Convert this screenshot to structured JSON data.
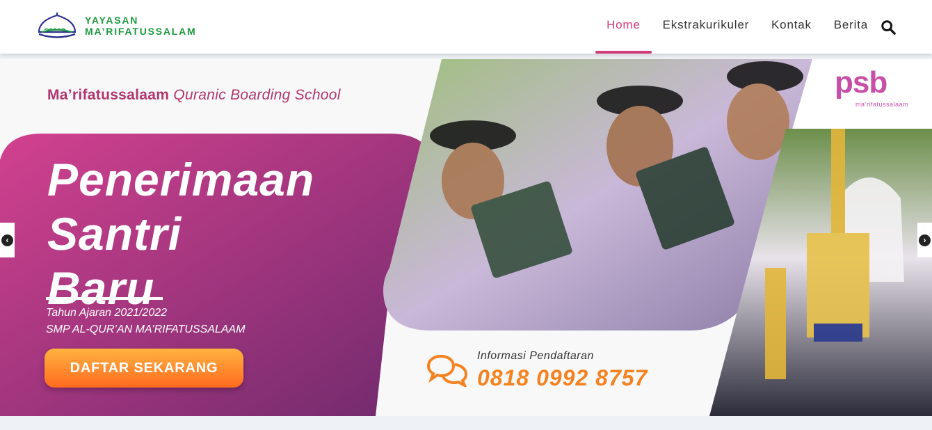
{
  "header": {
    "logo_line1": "YAYASAN",
    "logo_line2": "MA’RIFATUSSALAM",
    "nav": [
      {
        "label": "Home",
        "active": true
      },
      {
        "label": "Ekstrakurikuler",
        "active": false
      },
      {
        "label": "Kontak",
        "active": false
      },
      {
        "label": "Berita",
        "active": false
      }
    ],
    "search_icon": "search-icon"
  },
  "banner": {
    "tagline_bold": "Ma’rifatussalaam",
    "tagline_italic": "Quranic Boarding School",
    "headline_line1": "Penerimaan",
    "headline_line2": "Santri",
    "headline_line3": "Baru",
    "sub_line1": "Tahun Ajaran 2021/2022",
    "sub_line2": "SMP AL-QUR’AN MA’RIFATUSSALAAM",
    "cta_label": "DAFTAR SEKARANG",
    "info_label": "Informasi Pendaftaran",
    "info_phone": "0818 0992 8757",
    "psb_logo_text": "psb",
    "psb_logo_sub": "ma’rifatussalaam"
  },
  "colors": {
    "brand_green": "#1a9a3c",
    "accent_pink": "#d13b7b",
    "magenta": "#b0356f",
    "orange": "#f58220"
  }
}
